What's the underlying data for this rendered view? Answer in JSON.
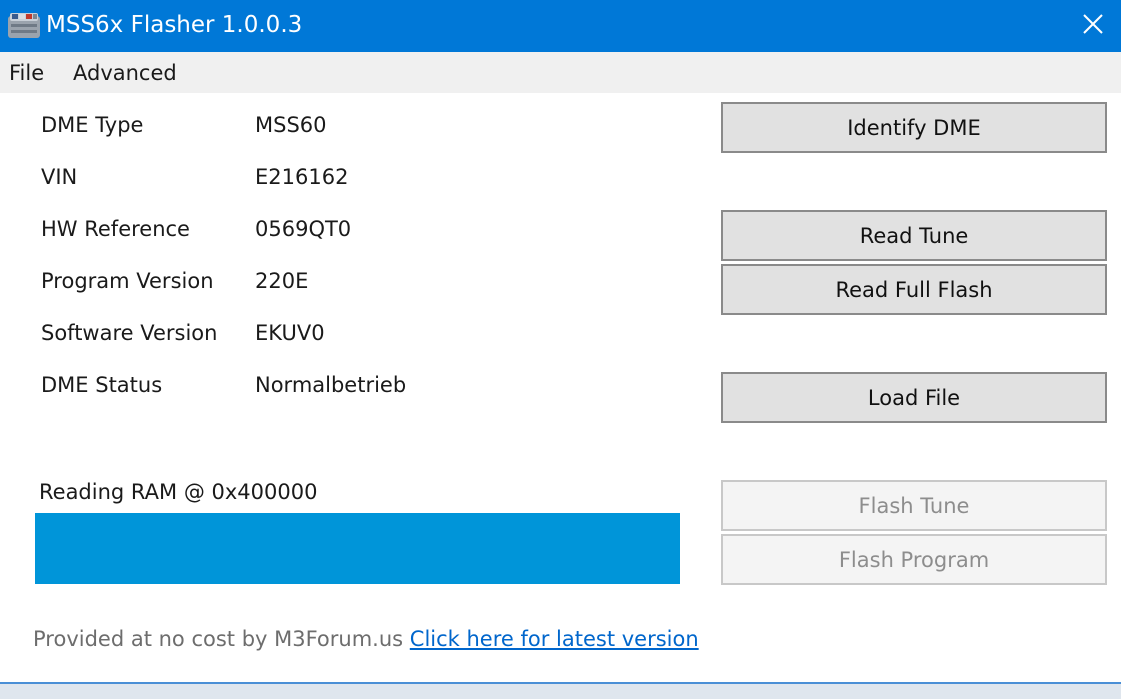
{
  "window": {
    "title": "MSS6x Flasher 1.0.0.3",
    "accent_color": "#0078d7",
    "icon": "app-icon",
    "close_icon": "close-icon"
  },
  "menu": {
    "file": "File",
    "advanced": "Advanced"
  },
  "info": {
    "dme_type_label": "DME Type",
    "dme_type_value": "MSS60",
    "vin_label": "VIN",
    "vin_value": "E216162",
    "hw_ref_label": "HW Reference",
    "hw_ref_value": "0569QT0",
    "program_version_label": "Program Version",
    "program_version_value": "220E",
    "software_version_label": "Software Version",
    "software_version_value": "EKUV0",
    "dme_status_label": "DME Status",
    "dme_status_value": "Normalbetrieb"
  },
  "buttons": {
    "identify_dme": "Identify DME",
    "read_tune": "Read Tune",
    "read_full_flash": "Read Full Flash",
    "load_file": "Load File",
    "flash_tune": "Flash Tune",
    "flash_program": "Flash Program"
  },
  "status": {
    "message": "Reading RAM @ 0x400000",
    "progress_percent": 100,
    "progress_color": "#0095d9"
  },
  "footer": {
    "text": "Provided at no cost by M3Forum.us ",
    "link": "Click here for latest version",
    "link_color": "#0066cc"
  }
}
